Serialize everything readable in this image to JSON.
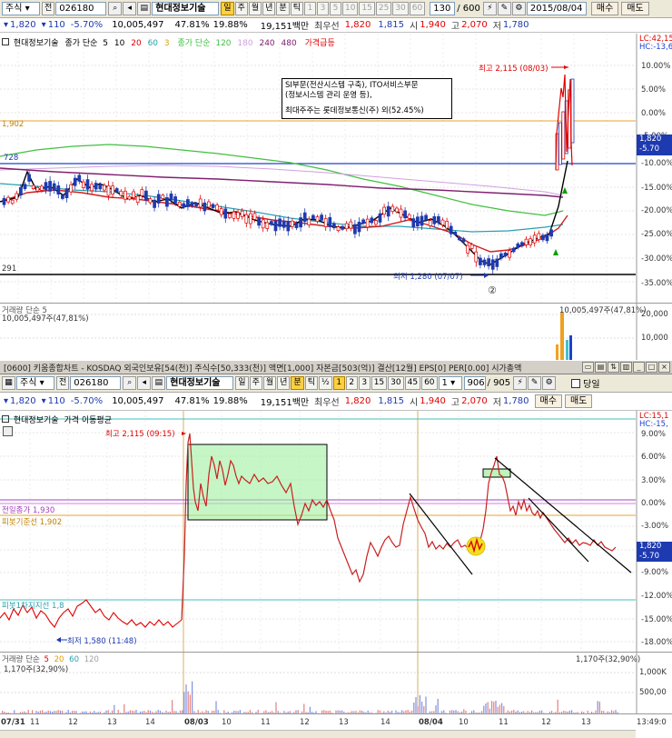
{
  "top": {
    "toolbar": {
      "market": "주식",
      "prev_label": "전",
      "code": "026180",
      "stock_name": "현대정보기술",
      "period_day": "일",
      "period_week": "주",
      "period_month": "월",
      "period_year": "년",
      "period_min": "분",
      "period_tick": "틱",
      "intervals": [
        "1",
        "3",
        "5",
        "10",
        "15",
        "25",
        "30",
        "60"
      ],
      "count": "130",
      "count_total": "/ 600",
      "date": "2015/08/04",
      "buy": "매수",
      "sell": "매도"
    },
    "quote": {
      "price": "1,820",
      "change": "110",
      "change_pct": "-5.70%",
      "volume": "10,005,497",
      "vol_ratio": "47.81%",
      "turnover": "19.88%",
      "amount": "19,151백만",
      "best_label": "최우선",
      "ask": "1,820",
      "bid": "1,815",
      "open_label": "시",
      "open": "1,940",
      "high_label": "고",
      "high": "2,070",
      "low_label": "저",
      "low": "1,780"
    },
    "legend": {
      "name": "현대정보기술",
      "ma_label": "종가 단순",
      "ma_periods": [
        "5",
        "10",
        "20",
        "60",
        "3"
      ],
      "ma_label2": "종가 단순",
      "ma_periods2": [
        "120",
        "180",
        "240",
        "480"
      ],
      "flag": "가격급등"
    },
    "annotation_lines": [
      "SI부문(전산시스템 구축), ITO서비스부문",
      "(정보시스템 관리 운영 등),",
      "",
      "최대주주는 롯데정보통신(주) 외(52.45%)"
    ],
    "high_label": "최고 2,115 (08/03)",
    "low_label": "최저 1,280 (07/07)",
    "circle_label": "②",
    "left_levels": [
      "1,902",
      "728",
      "291"
    ],
    "right_axis": [
      "LC:42,15",
      "HC:-13,6",
      "10.00%",
      "5.00%",
      "0.00%",
      "-5.00%",
      "-10.00%",
      "-15.00%",
      "-20.00%",
      "-25.00%",
      "-30.00%",
      "-35.00%"
    ],
    "price_tag": "1,820",
    "price_tag_pct": "-5.70",
    "volume_legend": "거래량 단순 5",
    "volume_value": "10,005,497주(47,81%)",
    "volume_right_value": "10,005,497주(47,81%)",
    "volume_axis": [
      "20,000",
      "10,000"
    ]
  },
  "middle_bar": {
    "text": "[0600] 키움종합차트 - KOSDAQ 외국인보유[54(천)] 주식수[50,333(천)] 액면[1,000] 자본금[503(억)] 결산[12월] EPS[0] PER[0.00] 시가총액"
  },
  "bottom": {
    "toolbar": {
      "market": "주식",
      "prev_label": "전",
      "code": "026180",
      "stock_name": "현대정보기술",
      "period_day": "일",
      "period_week": "주",
      "period_month": "월",
      "period_year": "년",
      "period_min": "분",
      "period_tick": "틱",
      "half": "½",
      "intervals": [
        "1",
        "2",
        "3",
        "15",
        "30",
        "45",
        "60"
      ],
      "count_prefix": "1",
      "count": "906",
      "count_total": "/ 905",
      "today_label": "당일"
    },
    "quote": {
      "price": "1,820",
      "change": "110",
      "change_pct": "-5.70%",
      "volume": "10,005,497",
      "vol_ratio": "47.81%",
      "turnover": "19.88%",
      "amount": "19,151백만",
      "best_label": "최우선",
      "ask": "1,820",
      "bid": "1,815",
      "open_label": "시",
      "open": "1,940",
      "high_label": "고",
      "high": "2,070",
      "low_label": "저",
      "low": "1,780",
      "buy": "매수",
      "sell": "매도"
    },
    "legend_name": "현대정보기술",
    "legend_ma": "가격 이동평균",
    "high_label": "최고 2,115 (09:15)",
    "low_label": "최저 1,580 (11:48)",
    "level_labels": [
      "전일종가 1,930",
      "피봇기준선 1,902",
      "피봇1차지지선 1,8"
    ],
    "right_axis": [
      "LC:15,1",
      "HC:-15,",
      "9.00%",
      "6.00%",
      "3.00%",
      "0.00%",
      "-3.00%",
      "-6.00%",
      "-9.00%",
      "-12.00%",
      "-15.00%",
      "-18.00%"
    ],
    "price_tag": "1,820",
    "price_tag_pct": "-5.70",
    "volume_legend_name": "거래량 단순",
    "volume_legend_periods": [
      "5",
      "20",
      "60",
      "120"
    ],
    "volume_value": "1,170주(32,90%)",
    "volume_right_value": "1,170주(32,90%)",
    "volume_axis": [
      "1,000K",
      "500,00"
    ],
    "x_labels": [
      "07/31",
      "11",
      "12",
      "13",
      "14",
      "08/03",
      "10",
      "11",
      "12",
      "13",
      "14",
      "08/04",
      "10",
      "11",
      "12",
      "13"
    ],
    "clock": "13:49:0"
  }
}
